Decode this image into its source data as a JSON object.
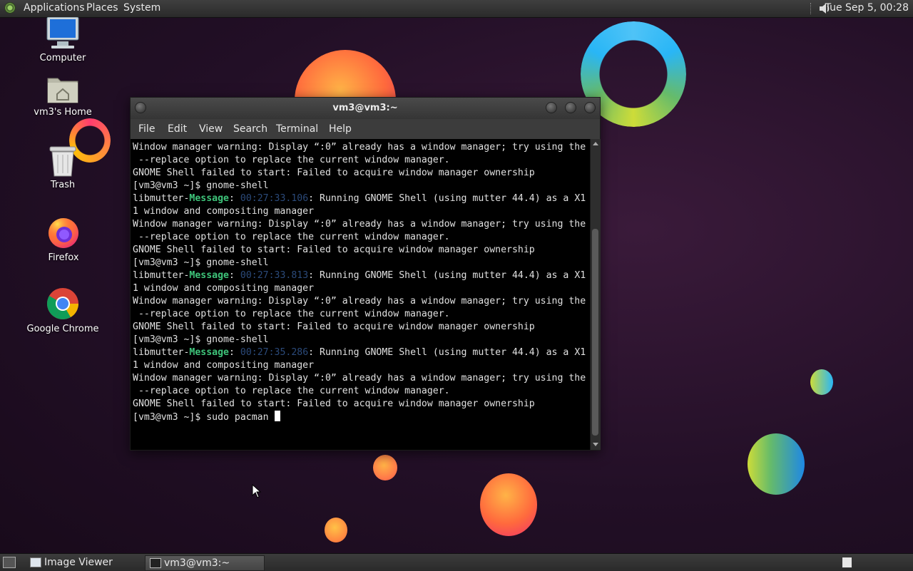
{
  "top_panel": {
    "menus": [
      "Applications",
      "Places",
      "System"
    ],
    "clock": "Tue Sep  5, 00:28"
  },
  "desktop_icons": [
    {
      "label": "Computer",
      "icon": "computer-icon"
    },
    {
      "label": "vm3's Home",
      "icon": "home-folder-icon"
    },
    {
      "label": "Trash",
      "icon": "trash-icon"
    },
    {
      "label": "Firefox",
      "icon": "firefox-icon"
    },
    {
      "label": "Google Chrome",
      "icon": "chrome-icon"
    }
  ],
  "terminal": {
    "title": "vm3@vm3:~",
    "menu": [
      "File",
      "Edit",
      "View",
      "Search",
      "Terminal",
      "Help"
    ],
    "lines": [
      {
        "t": "Window manager warning: Display “:0” already has a window manager; try using the"
      },
      {
        "t": " --replace option to replace the current window manager."
      },
      {
        "t": "GNOME Shell failed to start: Failed to acquire window manager ownership"
      },
      {
        "t": "[vm3@vm3 ~]$ gnome-shell"
      },
      {
        "pre": "libmutter-",
        "msg": "Message",
        "sep": ": ",
        "ts": "00:27:33.106",
        "post": ": Running GNOME Shell (using mutter 44.4) as a X1"
      },
      {
        "t": "1 window and compositing manager"
      },
      {
        "t": "Window manager warning: Display “:0” already has a window manager; try using the"
      },
      {
        "t": " --replace option to replace the current window manager."
      },
      {
        "t": "GNOME Shell failed to start: Failed to acquire window manager ownership"
      },
      {
        "t": "[vm3@vm3 ~]$ gnome-shell"
      },
      {
        "pre": "libmutter-",
        "msg": "Message",
        "sep": ": ",
        "ts": "00:27:33.813",
        "post": ": Running GNOME Shell (using mutter 44.4) as a X1"
      },
      {
        "t": "1 window and compositing manager"
      },
      {
        "t": "Window manager warning: Display “:0” already has a window manager; try using the"
      },
      {
        "t": " --replace option to replace the current window manager."
      },
      {
        "t": "GNOME Shell failed to start: Failed to acquire window manager ownership"
      },
      {
        "t": "[vm3@vm3 ~]$ gnome-shell"
      },
      {
        "pre": "libmutter-",
        "msg": "Message",
        "sep": ": ",
        "ts": "00:27:35.286",
        "post": ": Running GNOME Shell (using mutter 44.4) as a X1"
      },
      {
        "t": "1 window and compositing manager"
      },
      {
        "t": "Window manager warning: Display “:0” already has a window manager; try using the"
      },
      {
        "t": " --replace option to replace the current window manager."
      },
      {
        "t": "GNOME Shell failed to start: Failed to acquire window manager ownership"
      }
    ],
    "prompt": "[vm3@vm3 ~]$ sudo pacman "
  },
  "bottom_panel": {
    "tasks": [
      {
        "label": "Image Viewer",
        "active": false
      },
      {
        "label": "vm3@vm3:~",
        "active": true
      }
    ]
  },
  "colors": {
    "message_green": "#3ec47a",
    "timestamp_blue": "#2b4a7a"
  }
}
